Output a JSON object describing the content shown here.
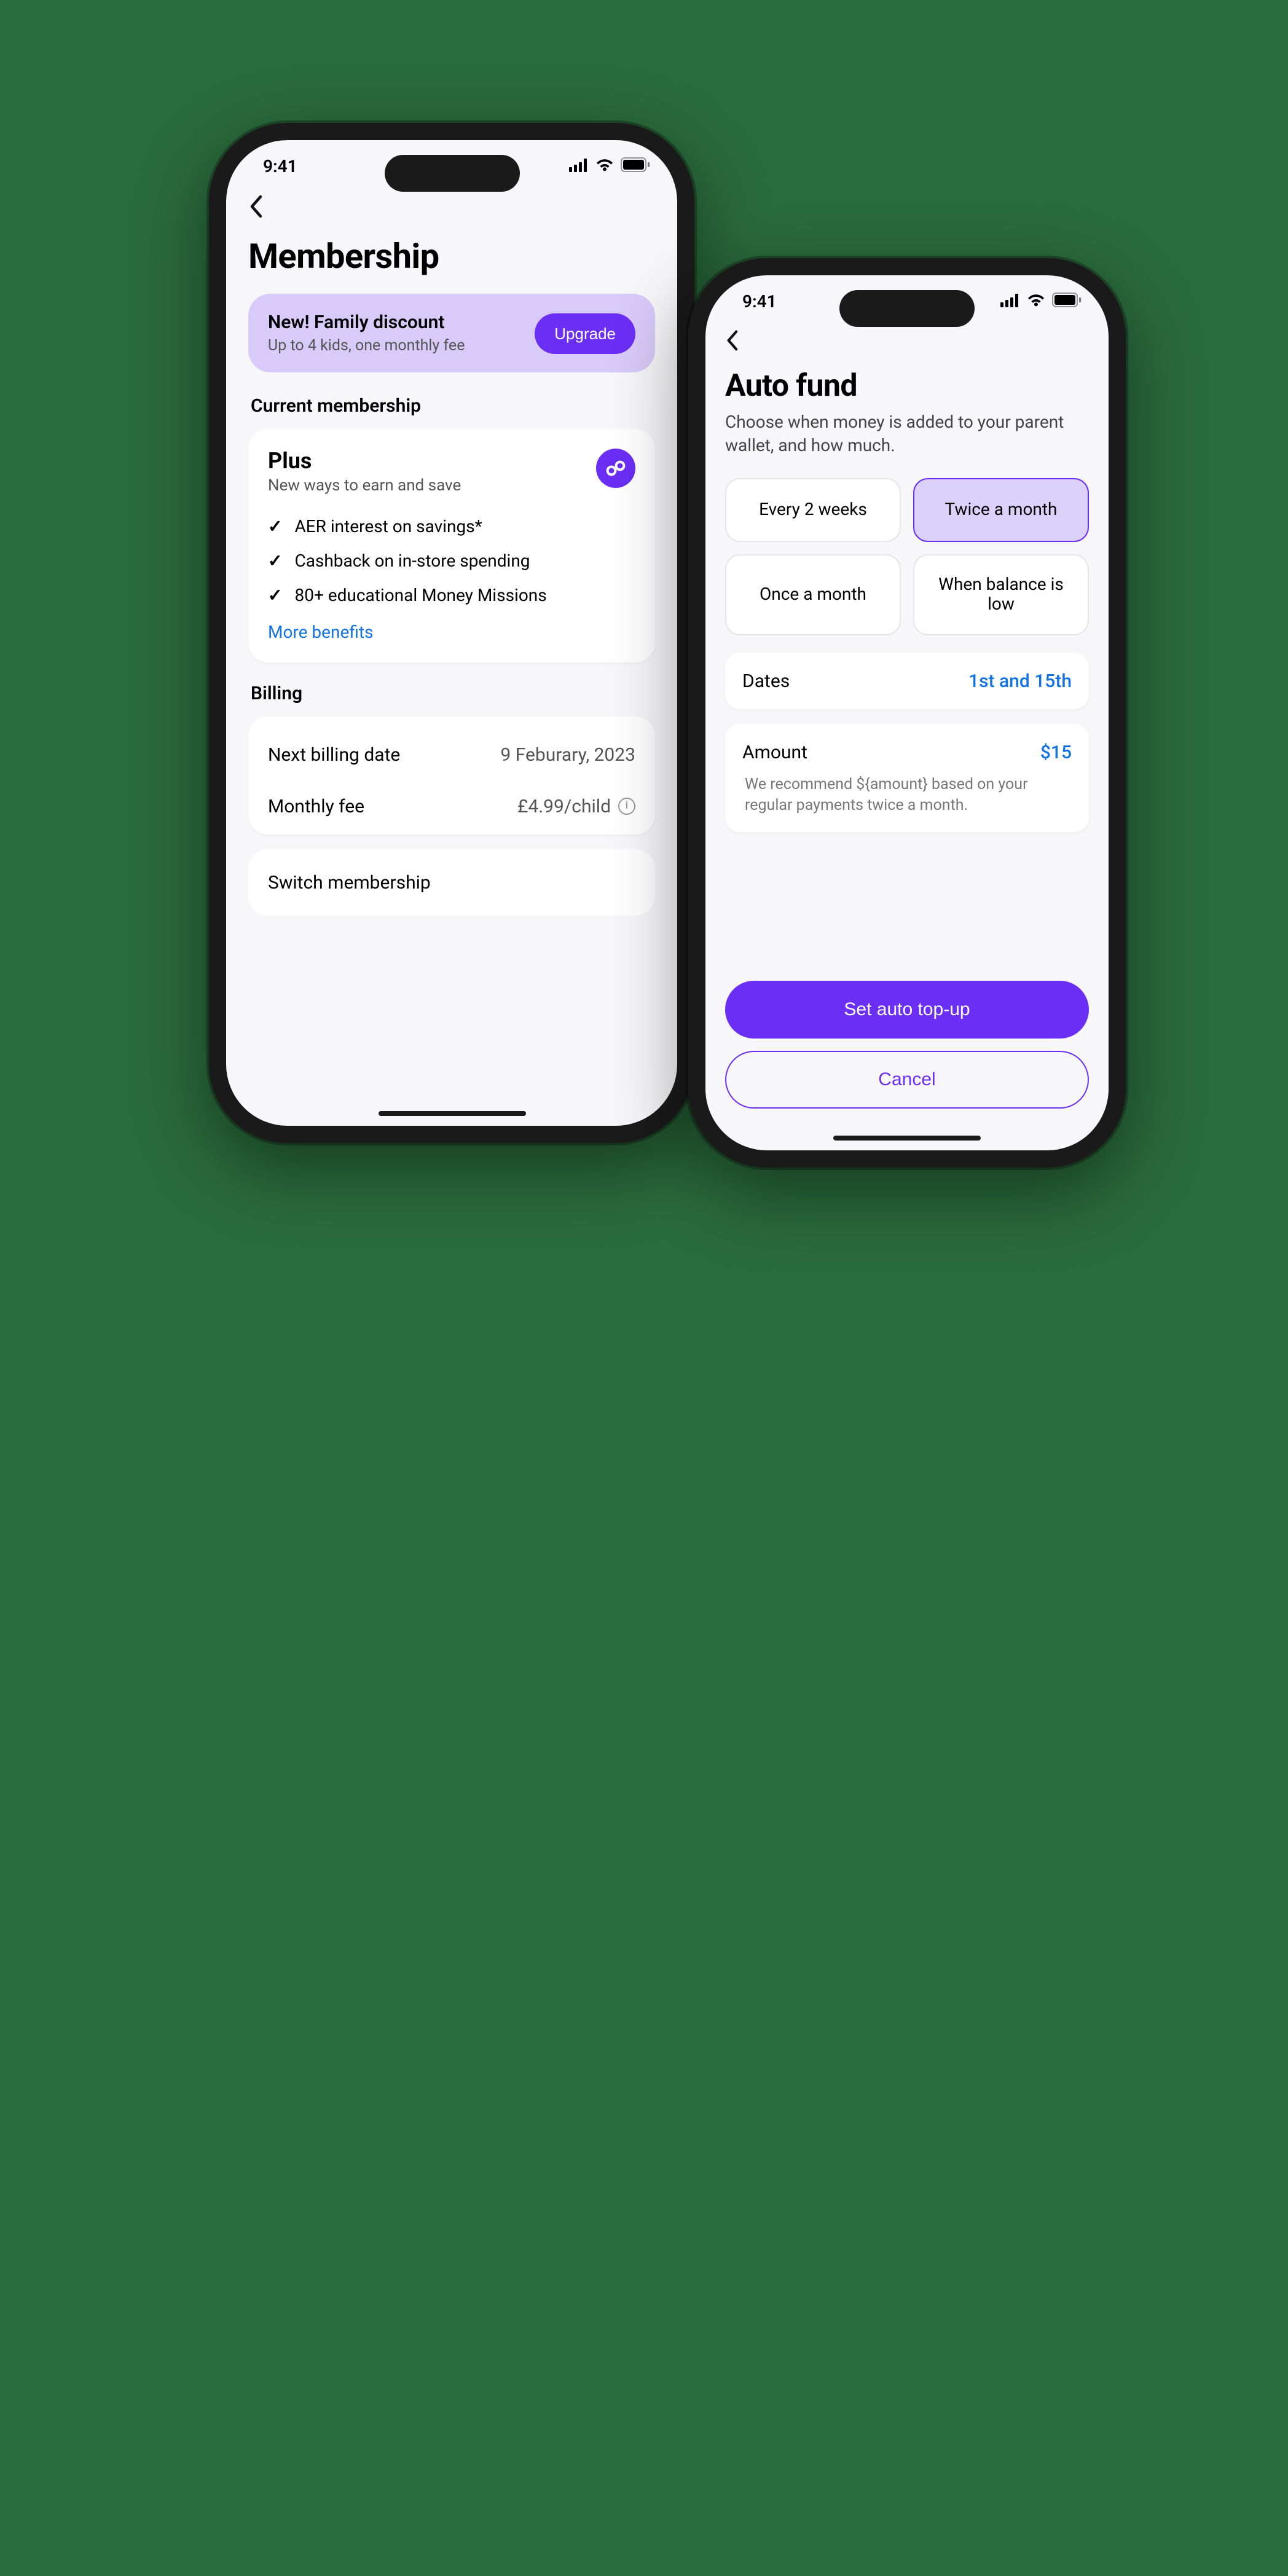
{
  "status": {
    "time": "9:41"
  },
  "membership": {
    "title": "Membership",
    "promo": {
      "title": "New! Family discount",
      "subtitle": "Up to 4 kids, one monthly fee",
      "cta": "Upgrade"
    },
    "current_heading": "Current membership",
    "plan": {
      "name": "Plus",
      "tagline": "New ways to earn and save",
      "benefits": [
        "AER interest on savings*",
        "Cashback on in-store spending",
        "80+ educational Money Missions"
      ],
      "more": "More benefits"
    },
    "billing_heading": "Billing",
    "billing": {
      "next_label": "Next billing date",
      "next_value": "9 Feburary, 2023",
      "fee_label": "Monthly fee",
      "fee_value": "£4.99/child"
    },
    "switch": "Switch membership"
  },
  "autofund": {
    "title": "Auto fund",
    "subtitle": "Choose when money is added to your parent wallet, and how much.",
    "frequencies": [
      {
        "label": "Every 2 weeks",
        "selected": false
      },
      {
        "label": "Twice a month",
        "selected": true
      },
      {
        "label": "Once a month",
        "selected": false
      },
      {
        "label": "When balance is low",
        "selected": false
      }
    ],
    "dates": {
      "label": "Dates",
      "value": "1st and 15th"
    },
    "amount": {
      "label": "Amount",
      "value": "$15"
    },
    "recommend": "We recommend ${amount} based on your regular payments twice a month.",
    "primary": "Set auto top-up",
    "secondary": "Cancel"
  }
}
